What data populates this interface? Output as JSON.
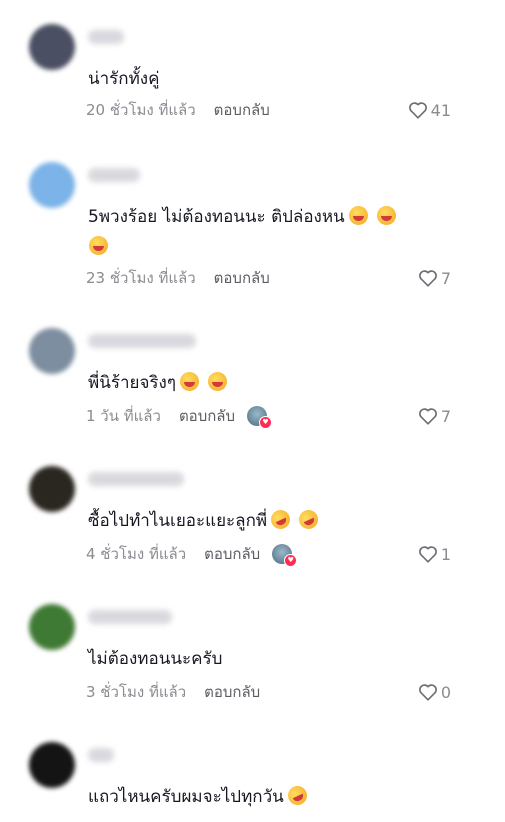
{
  "comments": [
    {
      "text": "น่ารักทั้งคู่",
      "emojis": [],
      "time": "20 ชั่วโมง ที่แล้ว",
      "reply": "ตอบกลับ",
      "likes": "41",
      "avatar_color": "#4a4f63",
      "liked_by_creator": false
    },
    {
      "text": "5พวงร้อย ไม่ต้องทอนนะ ติปล่องหน",
      "emojis": [
        "grinning-face-icon",
        "grinning-face-icon",
        "grinning-face-icon"
      ],
      "time": "23 ชั่วโมง ที่แล้ว",
      "reply": "ตอบกลับ",
      "likes": "7",
      "avatar_color": "#7cb3e8",
      "liked_by_creator": false
    },
    {
      "text": "พี่นิร้ายจริงๆ",
      "emojis": [
        "grinning-face-icon",
        "grinning-face-icon"
      ],
      "time": "1 วัน ที่แล้ว",
      "reply": "ตอบกลับ",
      "likes": "7",
      "avatar_color": "#7d8ea0",
      "liked_by_creator": true
    },
    {
      "text": "ซื้อไปทำไนเยอะแยะลูกพี่",
      "emojis": [
        "rolling-laughing-face-icon",
        "rolling-laughing-face-icon"
      ],
      "time": "4 ชั่วโมง ที่แล้ว",
      "reply": "ตอบกลับ",
      "likes": "1",
      "avatar_color": "#2a2620",
      "liked_by_creator": true
    },
    {
      "text": "ไม่ต้องทอนนะครับ",
      "emojis": [],
      "time": "3 ชั่วโมง ที่แล้ว",
      "reply": "ตอบกลับ",
      "likes": "0",
      "avatar_color": "#3f7a34",
      "liked_by_creator": false
    },
    {
      "text": "แถวไหนครับผมจะไปทุกวัน",
      "emojis": [
        "rolling-laughing-face-icon"
      ],
      "time": "",
      "reply": "",
      "likes": "",
      "avatar_color": "#141414",
      "liked_by_creator": false
    }
  ],
  "colors": {
    "time": "#8a8b91",
    "reply": "#5c5d63",
    "creator_heart": "#fe2c55"
  }
}
